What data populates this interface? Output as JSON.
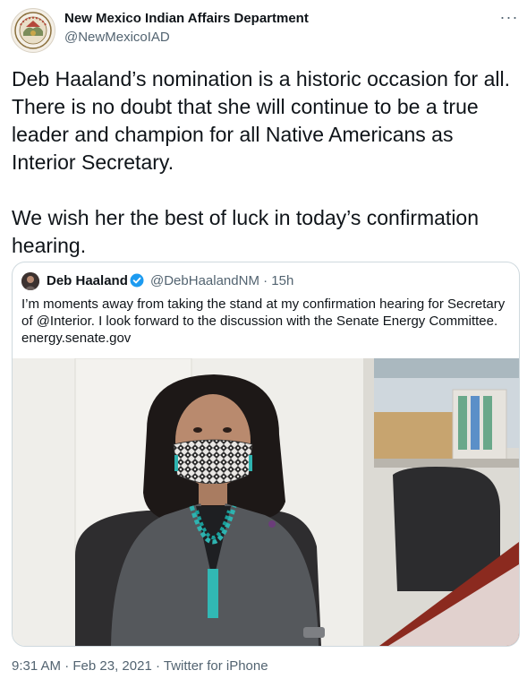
{
  "author": {
    "name": "New Mexico Indian Affairs Department",
    "handle": "@NewMexicoIAD",
    "avatar_icon": "state-seal-icon"
  },
  "tweet": {
    "paragraphs": [
      "Deb Haaland’s nomination is a historic occasion for all. There is no doubt that she will continue to be a true leader and champion for all Native Americans as Interior Secretary.",
      "We wish her the best of luck in today’s confirmation hearing."
    ]
  },
  "quoted": {
    "name": "Deb Haaland",
    "verified_icon": "verified-badge-icon",
    "handle_time": "@DebHaalandNM · 15h",
    "text": "I’m moments away from taking the stand at my confirmation hearing for Secretary of @Interior. I look forward to the discussion with the Senate Energy Committee.",
    "link": "energy.senate.gov",
    "photo_icon": "photo-woman-with-mask-icon"
  },
  "footer": {
    "time": "9:31 AM",
    "sep1": " · ",
    "date": "Feb 23, 2021",
    "sep2": " · ",
    "source": "Twitter for iPhone"
  },
  "colors": {
    "text": "#0f1419",
    "secondary": "#536471",
    "border": "#cfd9de",
    "verified": "#1d9bf0"
  }
}
